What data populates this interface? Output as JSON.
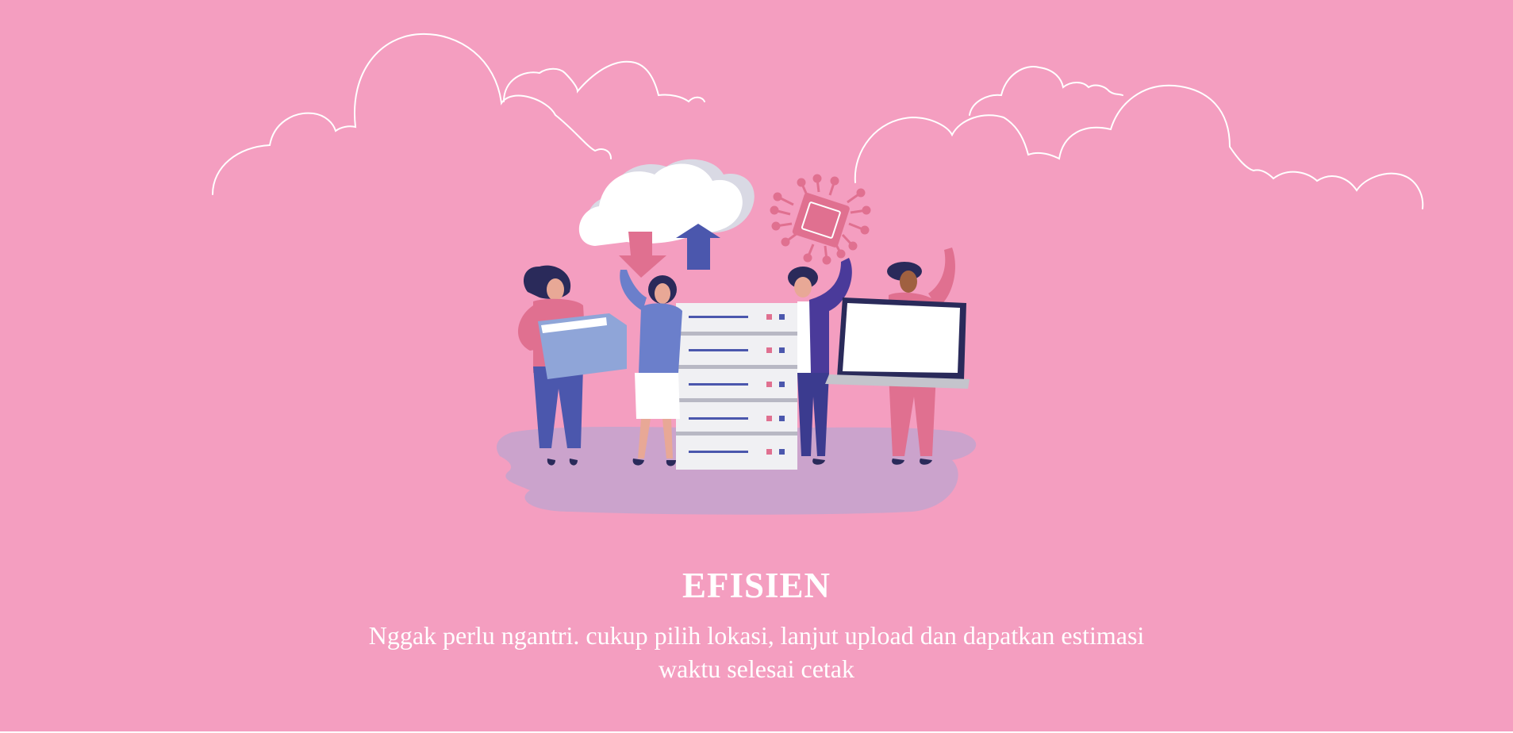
{
  "feature": {
    "title": "EFISIEN",
    "description_lines": [
      "Nggak perlu ngantri. cukup pilih lokasi, lanjut upload dan dapatkan estimasi",
      "waktu selesai cetak"
    ]
  },
  "illustration": {
    "icons": [
      "cloud-outline-icon",
      "cloud-icon",
      "download-arrow-icon",
      "upload-arrow-icon",
      "chip-icon",
      "folder-icon",
      "server-icon",
      "laptop-icon"
    ]
  },
  "colors": {
    "background": "#f49ec0",
    "text": "#ffffff",
    "shadow": "#cba3cc",
    "accent_pink": "#e07090",
    "accent_blue": "#4b57ad",
    "navy": "#2a2a5a"
  }
}
